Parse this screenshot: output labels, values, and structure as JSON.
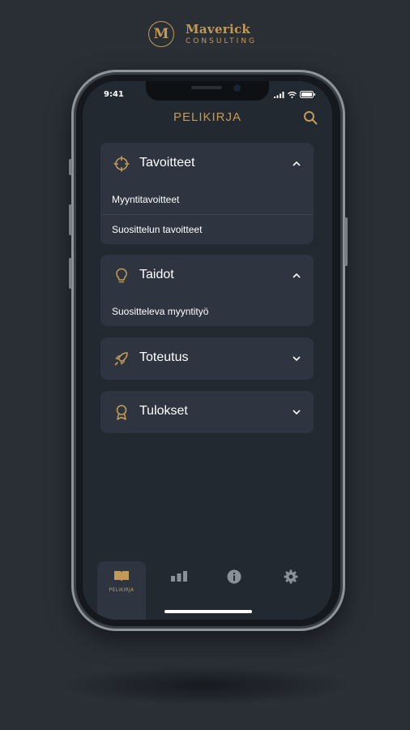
{
  "brand": {
    "mark": "M",
    "name": "Maverick",
    "subtitle": "CONSULTING"
  },
  "status_bar": {
    "time": "9:41"
  },
  "header": {
    "title": "PELIKIRJA"
  },
  "sections": [
    {
      "title": "Tavoitteet",
      "icon": "crosshair-icon",
      "expanded": true,
      "items": [
        "Myyntitavoitteet",
        "Suosittelun tavoitteet"
      ]
    },
    {
      "title": "Taidot",
      "icon": "lightbulb-icon",
      "expanded": true,
      "items": [
        "Suositteleva myyntityö"
      ]
    },
    {
      "title": "Toteutus",
      "icon": "rocket-icon",
      "expanded": false,
      "items": []
    },
    {
      "title": "Tulokset",
      "icon": "award-icon",
      "expanded": false,
      "items": []
    }
  ],
  "tabbar": {
    "tabs": [
      {
        "label": "PELIKIRJA",
        "icon": "book-icon",
        "active": true
      },
      {
        "label": "",
        "icon": "bar-chart-icon",
        "active": false
      },
      {
        "label": "",
        "icon": "info-icon",
        "active": false
      },
      {
        "label": "",
        "icon": "gear-icon",
        "active": false
      }
    ]
  },
  "colors": {
    "accent": "#c39a55",
    "background": "#2a2f36",
    "screen": "#232931",
    "card": "#2e3540",
    "icon_muted": "#8a9099"
  }
}
